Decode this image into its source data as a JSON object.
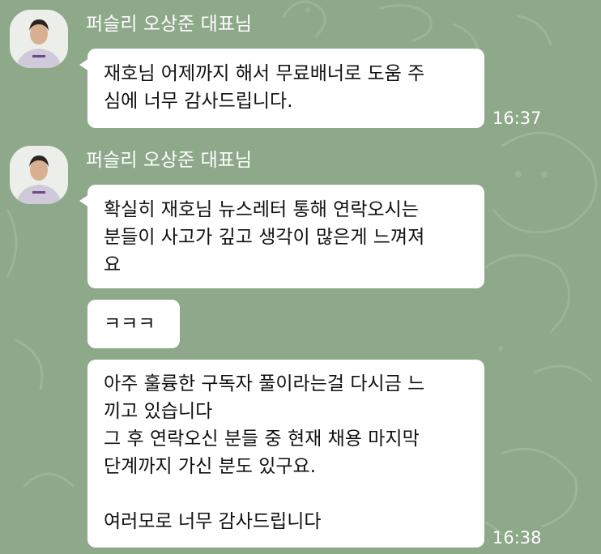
{
  "colors": {
    "background": "#8ea88a",
    "bubble": "#ffffff",
    "sender_text": "#ffffff",
    "time_text": "#ffffff"
  },
  "messages": [
    {
      "sender": "퍼슬리 오상준 대표님",
      "bubbles": [
        "재호님 어제까지 해서 무료배너로 도움 주\n심에 너무 감사드립니다."
      ],
      "time": "16:37"
    },
    {
      "sender": "퍼슬리 오상준 대표님",
      "bubbles": [
        "확실히 재호님 뉴스레터 통해 연락오시는\n분들이 사고가 깊고 생각이 많은게 느껴져\n요",
        "ㅋㅋㅋ",
        "아주 훌륭한 구독자 풀이라는걸 다시금 느\n끼고 있습니다\n그 후 연락오신 분들 중 현재 채용 마지막\n단계까지 가신 분도 있구요.\n\n여러모로 너무 감사드립니다"
      ],
      "time": "16:38"
    }
  ]
}
